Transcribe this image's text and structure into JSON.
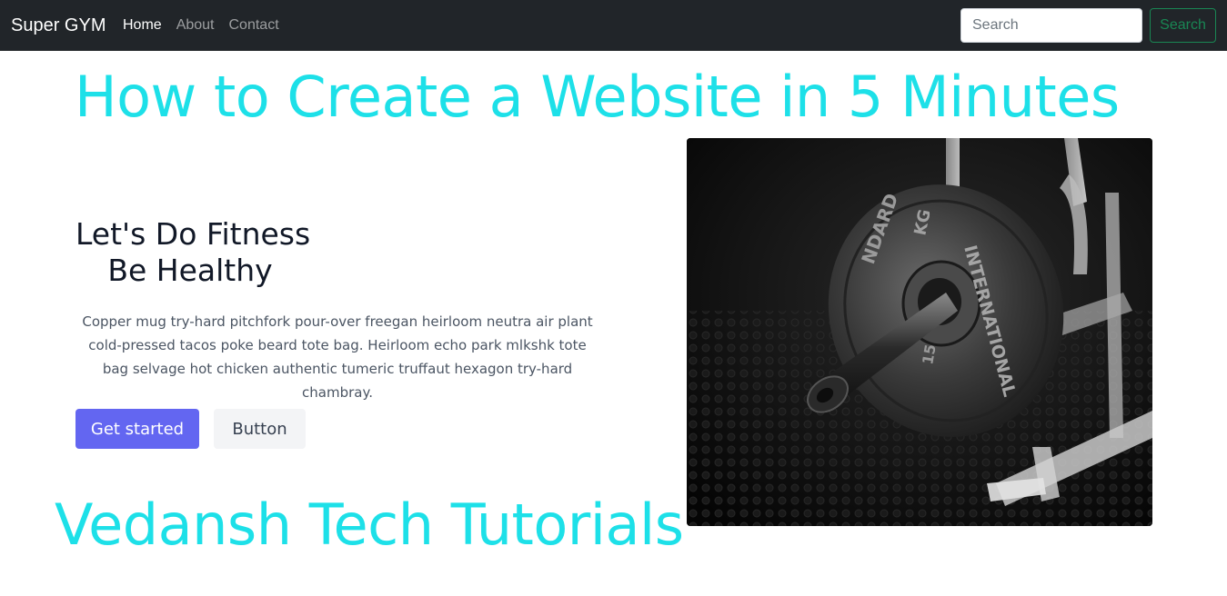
{
  "navbar": {
    "brand": "Super GYM",
    "links": [
      {
        "label": "Home",
        "active": true
      },
      {
        "label": "About",
        "active": false
      },
      {
        "label": "Contact",
        "active": false
      }
    ],
    "search_placeholder": "Search",
    "search_button": "Search"
  },
  "overlay": {
    "headline": "How to Create a Website in 5 Minutes",
    "footer_title": "Vedansh Tech Tutorials",
    "color": "#1de0e8"
  },
  "hero": {
    "title_line1": "Let's Do Fitness",
    "title_line2": "Be Healthy",
    "text": "Copper mug try-hard pitchfork pour-over freegan heirloom neutra air plant cold-pressed tacos poke beard tote bag. Heirloom echo park mlkshk tote bag selvage hot chicken authentic tumeric truffaut hexagon try-hard chambray.",
    "primary_button": "Get started",
    "secondary_button": "Button",
    "accent_color": "#6366f1"
  },
  "image": {
    "plate_text_top": "NDARD    KG",
    "plate_text_right": "INTERNATIONAL",
    "plate_number": "15"
  }
}
